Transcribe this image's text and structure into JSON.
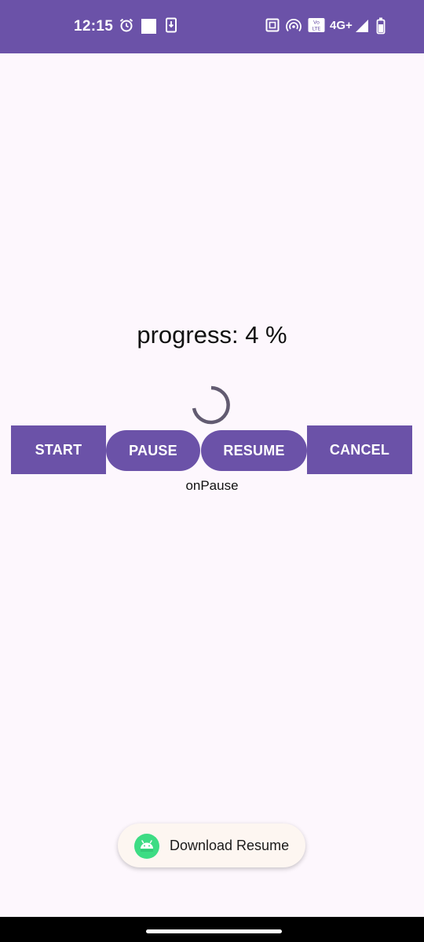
{
  "status_bar": {
    "time": "12:15",
    "network": "4G+",
    "volte": "Vo LTE",
    "icons": [
      "alarm-icon",
      "notification-square-icon",
      "download-icon",
      "nfc-icon",
      "hotspot-icon",
      "volte-icon",
      "signal-icon",
      "battery-icon"
    ],
    "color": "#6B52A8"
  },
  "main": {
    "progress_label": "progress: 4 %",
    "progress_value": 4,
    "state_text": "onPause"
  },
  "buttons": {
    "start": "START",
    "pause": "PAUSE",
    "resume": "RESUME",
    "cancel": "CANCEL"
  },
  "toast": {
    "text": "Download Resume",
    "icon": "android-icon"
  },
  "colors": {
    "accent": "#6B52A8",
    "background": "#FDF7FD",
    "spinner": "#625B71",
    "android_green": "#3DDC84"
  }
}
